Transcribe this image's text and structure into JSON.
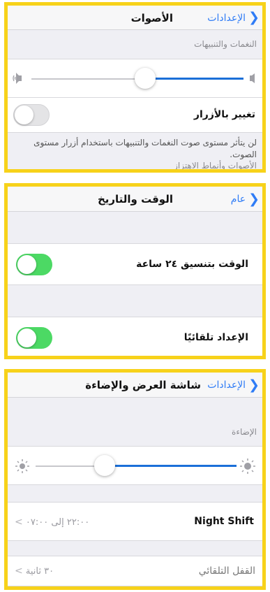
{
  "panel1": {
    "back_label": "الإعدادات",
    "title": "الأصوات",
    "section_label": "النغمات والتنبيهات",
    "slider_level": 0.57,
    "toggle_label": "تغيير بالأزرار",
    "toggle_on": false,
    "footnote": "لن يتأثر مستوى صوت النغمات والتنبيهات باستخدام أزرار مستوى الصوت.",
    "next_section_label": "الأصوات وأنماط الاهتزاز"
  },
  "panel2": {
    "back_label": "عام",
    "title": "الوقت والتاريخ",
    "row1_label": "الوقت بتنسيق ٢٤ ساعة",
    "row1_on": true,
    "row2_label": "الإعداد تلقائيًا",
    "row2_on": true
  },
  "panel3": {
    "back_label": "الإعدادات",
    "title": "شاشة العرض والإضاءة",
    "section_label": "الإضاءة",
    "brightness_level": 0.45,
    "night_shift_label": "Night Shift",
    "night_shift_value": "٢٢:٠٠ إلى ٠٧:٠٠",
    "autolock_label": "القفل التلقائي",
    "autolock_value": "٣٠ ثانية"
  },
  "colors": {
    "accent": "#2f7cf6",
    "toggle_on": "#4cd964",
    "highlight_border": "#f7d21a",
    "slider_fill": "#1b6fd8"
  },
  "icons": {
    "back": "chevron-left-icon",
    "speaker_low": "speaker-low-icon",
    "speaker_high": "speaker-high-icon",
    "sun_small": "sun-small-icon",
    "sun_large": "sun-large-icon"
  }
}
